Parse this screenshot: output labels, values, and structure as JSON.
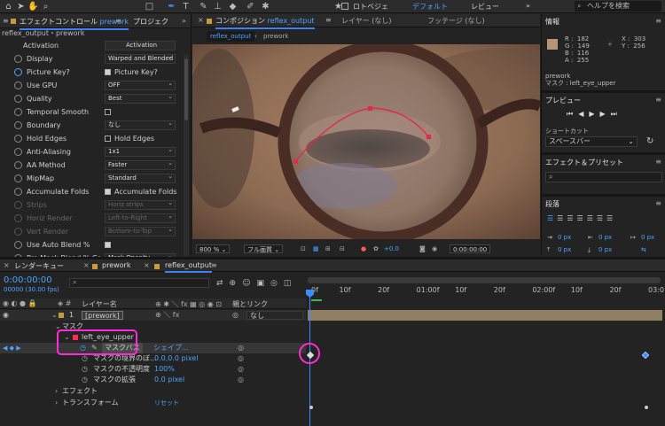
{
  "topbar": {
    "workspaces": [
      "ロトベジェ",
      "デフォルト",
      "レビュー"
    ],
    "search_placeholder": "ヘルプを検索"
  },
  "effect_controls": {
    "tab_label": "エフェクトコントロール",
    "tab_comp": "prework",
    "tab2_label": "プロジェク",
    "subtitle": "reflex_output・prework",
    "activation_label": "Activation",
    "activation_btn": "Activation",
    "rows": [
      {
        "label": "Display",
        "type": "dd",
        "value": "Warped and Blended"
      },
      {
        "label": "Picture Key?",
        "type": "cb",
        "value": "Picture Key?",
        "checked": true
      },
      {
        "label": "Use GPU",
        "type": "dd",
        "value": "OFF"
      },
      {
        "label": "Quality",
        "type": "dd",
        "value": "Best"
      },
      {
        "label": "Temporal Smooth",
        "type": "cb",
        "value": "",
        "checked": false
      },
      {
        "label": "Boundary",
        "type": "dd",
        "value": "なし"
      },
      {
        "label": "Hold Edges",
        "type": "cb",
        "value": "Hold Edges",
        "checked": false
      },
      {
        "label": "Anti-Aliasing",
        "type": "dd",
        "value": "1x1"
      },
      {
        "label": "AA Method",
        "type": "dd",
        "value": "Faster"
      },
      {
        "label": "MipMap",
        "type": "dd",
        "value": "Standard"
      },
      {
        "label": "Accumulate Folds",
        "type": "cb",
        "value": "Accumulate Folds",
        "checked": true
      },
      {
        "label": "Strips",
        "type": "dd",
        "value": "Horiz strips",
        "dim": true
      },
      {
        "label": "Horiz Render",
        "type": "dd",
        "value": "Left-to-Right",
        "dim": true
      },
      {
        "label": "Vert Render",
        "type": "dd",
        "value": "Bottom-to-Top",
        "dim": true
      },
      {
        "label": "Use Auto Blend %",
        "type": "cb",
        "value": "",
        "checked": true
      },
      {
        "label": "Pre Mask Blend % Co",
        "type": "dd",
        "value": "Mask Opacity"
      }
    ]
  },
  "composition": {
    "tab_prefix": "コンポジション",
    "tab_name": "reflex_output",
    "tab_layer": "レイヤー (なし)",
    "tab_footage": "フッテージ (なし)",
    "breadcrumb": [
      "reflex_output",
      "prework"
    ],
    "zoom": "800 %",
    "resolution": "フル画質",
    "exposure": "+0.0",
    "timecode": "0:00:00:00"
  },
  "info_panel": {
    "title": "情報",
    "rgba": "R :  182\nG :  149\nB :  116\nA :  255",
    "xy": "X :  303\nY :  256",
    "layer": "prework",
    "mask": "マスク : left_eye_upper",
    "swatch": "#b69574"
  },
  "preview_panel": {
    "title": "プレビュー",
    "shortcut_label": "ショートカット",
    "shortcut_value": "スペースバー"
  },
  "effects_panel": {
    "title": "エフェクト＆プリセット"
  },
  "paragraph_panel": {
    "title": "段落",
    "values": [
      "0 px",
      "0 px",
      "0 px",
      "0 px",
      "0 px"
    ]
  },
  "timeline": {
    "tabs": [
      "レンダーキュー",
      "prework",
      "reflex_output"
    ],
    "timecode": "0:00:00:00",
    "fps": "00000 (30.00 fps)",
    "header_layer": "レイヤー名",
    "header_parent": "親とリンク",
    "ruler": [
      "0f",
      "10f",
      "20f",
      "01:00f",
      "10f",
      "20f",
      "02:00f",
      "10f",
      "20f",
      "03:0"
    ],
    "layer_num": "1",
    "layer_name": "[prework]",
    "parent_value": "なし",
    "mask_group": "マスク",
    "mask_name": "left_eye_upper",
    "mask_path": "マスクパス",
    "mask_path_value": "シェイプ...",
    "mask_feather": "マスクの境界のぼ...",
    "mask_feather_value": "0.0,0.0 pixel",
    "mask_opacity": "マスクの不透明度",
    "mask_opacity_value": "100%",
    "mask_expansion": "マスクの拡張",
    "mask_expansion_value": "0.0 pixel",
    "effect": "エフェクト",
    "transform": "トランスフォーム",
    "reset": "リセット"
  },
  "colors": {
    "accent": "#3b8cff",
    "highlight": "#ff2bd6",
    "mask": "#ff2a4d"
  }
}
